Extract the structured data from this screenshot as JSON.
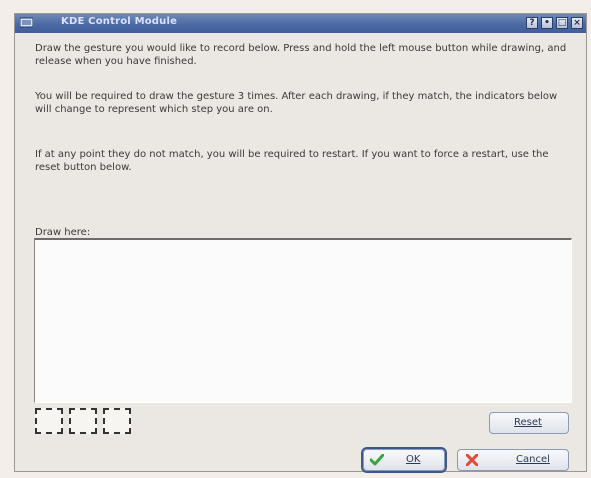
{
  "window": {
    "title": "KDE Control Module",
    "controls": [
      "?",
      "•",
      "□",
      "×"
    ]
  },
  "instructions": [
    "Draw the gesture you would like to record below. Press and hold the left mouse button while drawing, and release when you have finished.",
    "You will be required to draw the gesture 3 times. After each drawing, if they match, the indicators below will change to represent which step you are on.",
    "If at any point they do not match, you will be required to restart. If you want to force a restart, use the reset button below."
  ],
  "draw_label": "Draw here:",
  "indicators_count": 3,
  "buttons": {
    "reset": "Reset",
    "ok": "OK",
    "cancel": "Cancel"
  },
  "colors": {
    "titlebar": "#4c6aa4",
    "ok_icon": "#3aa33a",
    "cancel_icon": "#e24a3a"
  }
}
